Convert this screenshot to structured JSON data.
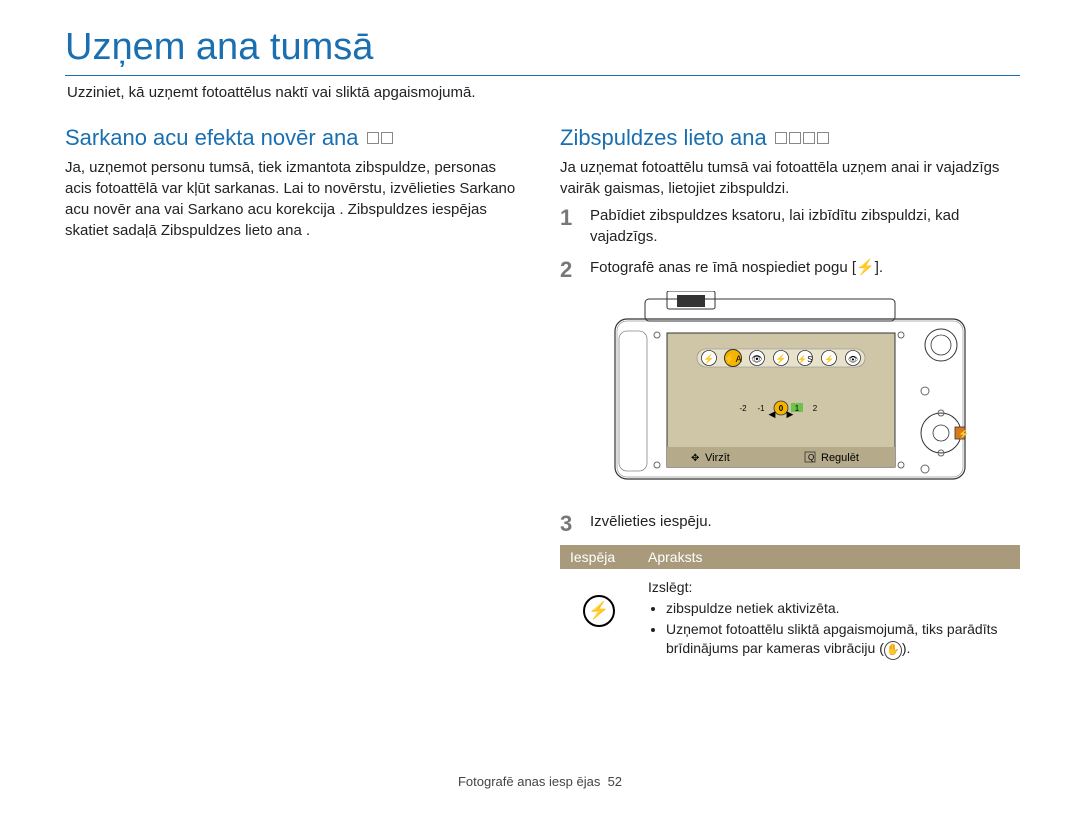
{
  "title": "Uzņem ana tumsā",
  "subtitle": "Uzziniet, kā uzņemt fotoattēlus naktī vai sliktā apgaismojumā.",
  "left": {
    "heading": "Sarkano acu efekta novēr ana",
    "para": "Ja, uzņemot personu tumsā, tiek izmantota zibspuldze, personas acis fotoattēlā var kļūt sarkanas. Lai to novērstu, izvēlieties Sarkano acu novēr ana vai Sarkano acu korekcija . Zibspuldzes iespējas skatiet sadaļā  Zibspuldzes lieto ana ."
  },
  "right": {
    "heading": "Zibspuldzes lieto ana",
    "intro": "Ja uzņemat fotoattēlu tumsā vai fotoattēla uzņem anai ir vajadzīgs vairāk gaismas, lietojiet zibspuldzi.",
    "step1": "Pabīdiet zibspuldzes ksatoru, lai izbīdītu zibspuldzi, kad vajadzīgs.",
    "step2": "Fotografē anas re  īmā nospiediet pogu [",
    "step2_suffix": "].",
    "step3": "Izvēlieties iespēju.",
    "table": {
      "h1": "Iespēja",
      "h2": "Apraksts",
      "row1": {
        "title": "Izslēgt:",
        "b1": "zibspuldze netiek aktivizēta.",
        "b2a": "Uzņemot fotoattēlu sliktā apgaismojumā, tiks parādīts brīdinājums par kameras vibrāciju (",
        "b2b": ")."
      }
    },
    "screen": {
      "virzit": "Virzīt",
      "regulet": "Regulēt",
      "scale_m2": "-2",
      "scale_m1": "-1",
      "scale_0": "0",
      "scale_p1": "1",
      "scale_p2": "2"
    }
  },
  "footer_text": "Fotografē anas iesp ējas",
  "footer_page": "52"
}
